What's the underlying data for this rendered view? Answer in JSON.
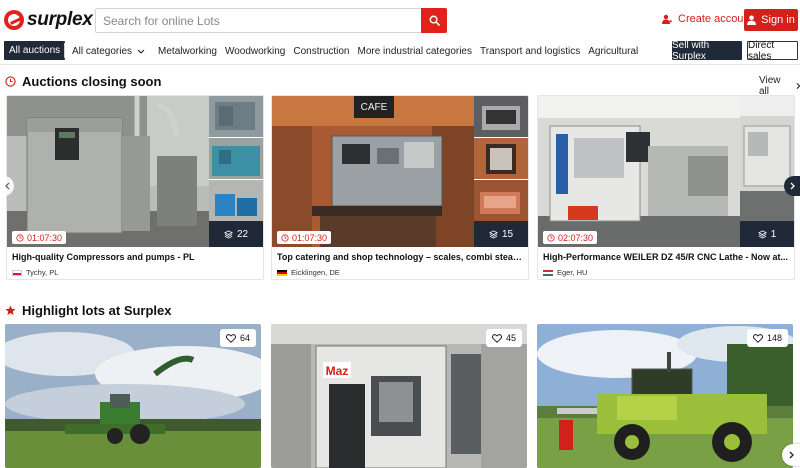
{
  "header": {
    "brand": "surplex",
    "search_placeholder": "Search for online Lots",
    "create_account": "Create account",
    "sign_in": "Sign in"
  },
  "nav": {
    "all_auctions": "All auctions",
    "all_categories": "All categories",
    "links": [
      "Metalworking",
      "Woodworking",
      "Construction",
      "More industrial categories",
      "Transport and logistics",
      "Agricultural"
    ],
    "sell": "Sell with Surplex",
    "direct_sales": "Direct sales"
  },
  "auctions": {
    "title": "Auctions closing soon",
    "view_all": "View all",
    "cards": [
      {
        "timer": "01:07:30",
        "count": "22",
        "title": "High-quality Compressors and pumps - PL",
        "location": "Tychy, PL",
        "flag": "PL"
      },
      {
        "timer": "01:07:30",
        "count": "15",
        "title": "Top catering and shop technology – scales, combi steamers,...",
        "location": "Eicklingen, DE",
        "flag": "DE"
      },
      {
        "timer": "02:07:30",
        "count": "1",
        "title": "High-Performance WEILER DZ 45/R CNC Lathe - Now at...",
        "location": "Eger, HU",
        "flag": "HU"
      }
    ],
    "cafe_sign": "CAFE"
  },
  "highlights": {
    "title": "Highlight lots at Surplex",
    "lots": [
      {
        "favorites": "64"
      },
      {
        "favorites": "45"
      },
      {
        "favorites": "148"
      }
    ],
    "machine_brand": "Maz"
  },
  "colors": {
    "accent": "#e0221b",
    "dark": "#1f2937"
  }
}
